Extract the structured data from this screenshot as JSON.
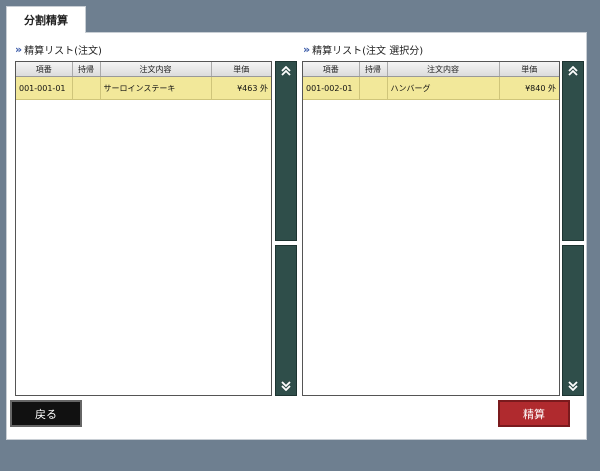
{
  "tab": {
    "label": "分割精算"
  },
  "left": {
    "title": "精算リスト(注文)",
    "headers": [
      "項番",
      "持帰",
      "注文内容",
      "単価"
    ],
    "rows": [
      {
        "no": "001-001-01",
        "takeout": "",
        "item": "サーロインステーキ",
        "price": "¥463 外"
      }
    ]
  },
  "right": {
    "title": "精算リスト(注文 選択分)",
    "headers": [
      "項番",
      "持帰",
      "注文内容",
      "単価"
    ],
    "rows": [
      {
        "no": "001-002-01",
        "takeout": "",
        "item": "ハンバーグ",
        "price": "¥840 外"
      }
    ]
  },
  "buttons": {
    "back": "戻る",
    "settle": "精算"
  },
  "colors": {
    "selected_row": "#f2e89a",
    "scroll_button": "#2f4e4a",
    "settle_button": "#b02a2e"
  },
  "icons": {
    "scroll_up": "double-chevron-up-icon",
    "scroll_down": "double-chevron-down-icon"
  }
}
